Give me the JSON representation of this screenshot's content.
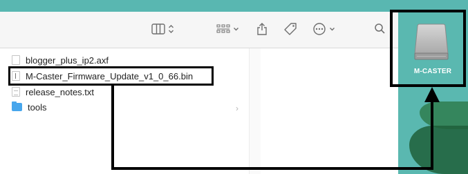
{
  "toolbar": {
    "icons": [
      "columns-view-icon",
      "grid-view-icon",
      "share-icon",
      "tag-icon",
      "more-actions-icon",
      "search-icon"
    ]
  },
  "files": [
    {
      "name": "blogger_plus_ip2.axf",
      "icon": "document-icon"
    },
    {
      "name": "M-Caster_Firmware_Update_v1_0_66.bin",
      "icon": "binary-file-icon"
    },
    {
      "name": "release_notes.txt",
      "icon": "text-file-icon"
    },
    {
      "name": "tools",
      "icon": "folder-icon"
    }
  ],
  "desktop": {
    "drive_label": "M-CASTER"
  },
  "annotation": {
    "color": "#000000"
  },
  "colors": {
    "desktop_teal": "#59b7b1",
    "folder_blue": "#47a6ec"
  }
}
